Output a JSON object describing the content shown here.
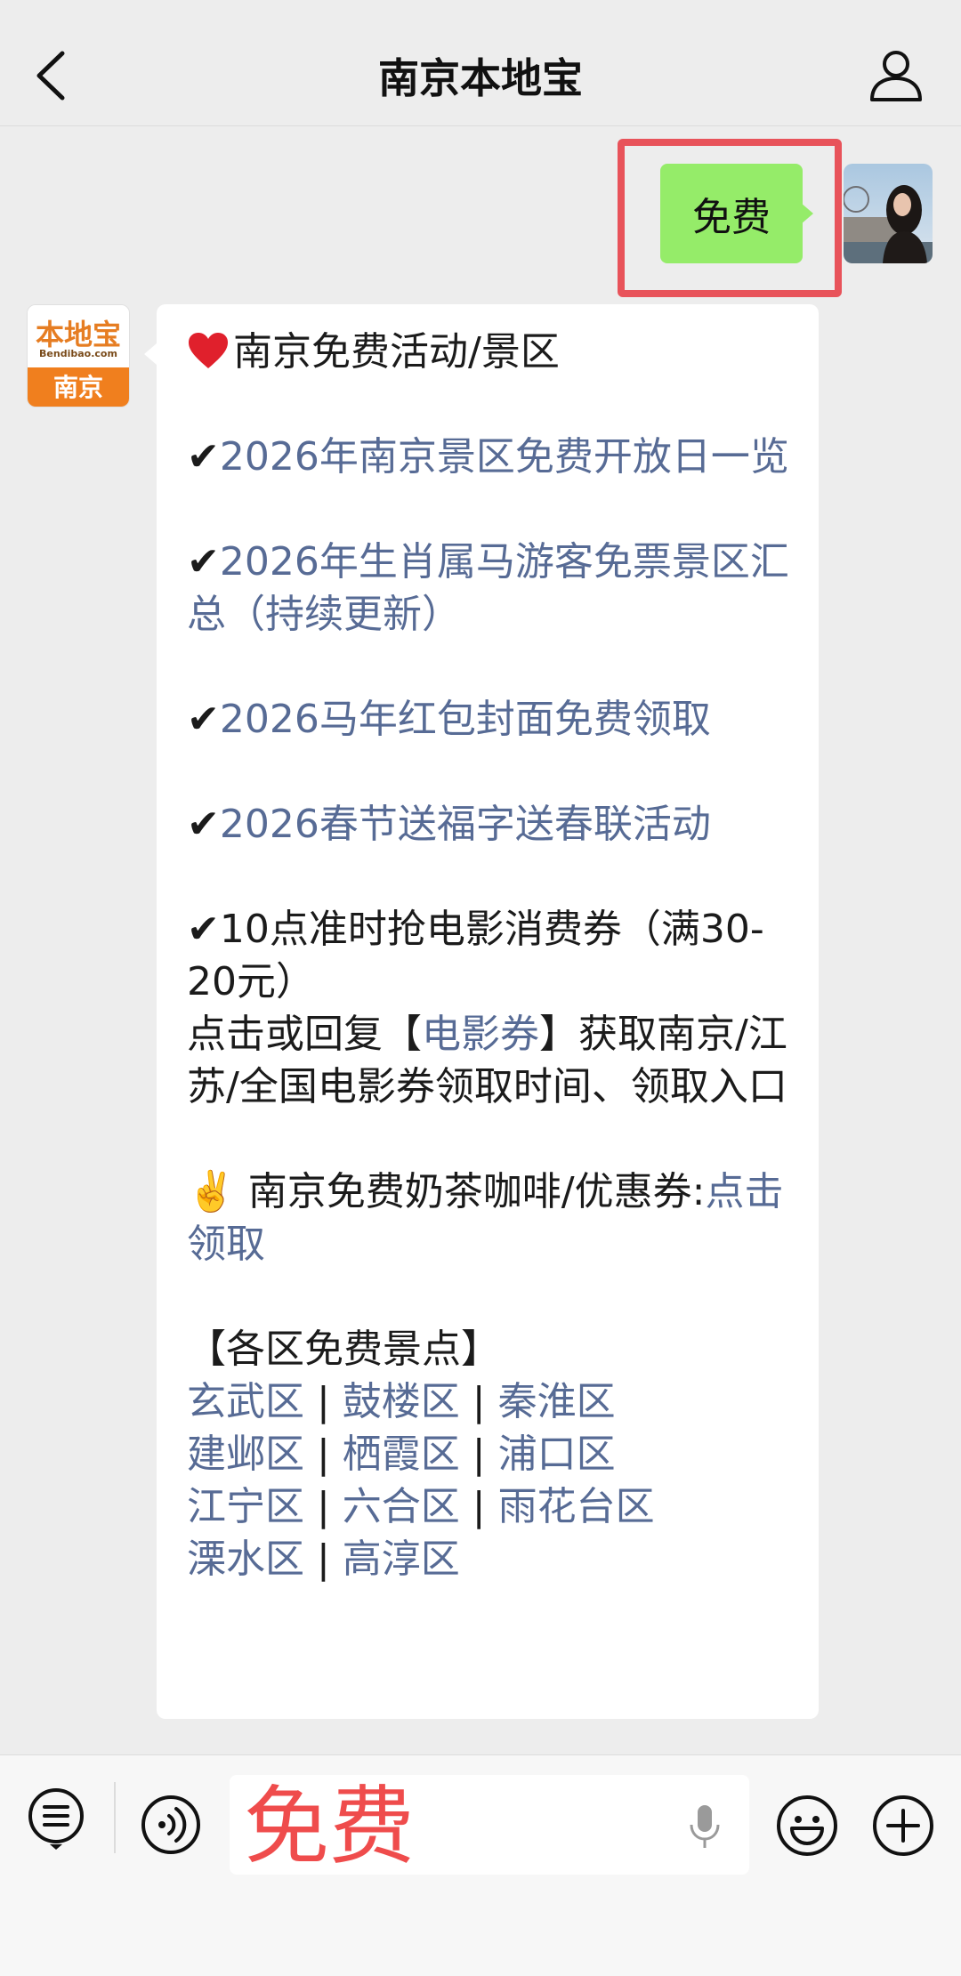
{
  "header": {
    "title": "南京本地宝"
  },
  "sent_message": {
    "text": "免费"
  },
  "bot": {
    "avatar_brand": "本地宝",
    "avatar_sub": "Bendibao.com",
    "avatar_city": "南京"
  },
  "reply": {
    "title": "南京免费活动/景区",
    "items": [
      {
        "check": "✔",
        "text": "2026年南京景区免费开放日一览"
      },
      {
        "check": "✔",
        "text": "2026年生肖属马游客免票景区汇总（持续更新）"
      },
      {
        "check": "✔",
        "text": "2026马年红包封面免费领取"
      },
      {
        "check": "✔",
        "text": "2026春节送福字送春联活动"
      }
    ],
    "movie": {
      "check": "✔",
      "line": "10点准时抢电影消费券（满30-20元）",
      "prefix": "点击或回复【",
      "link": "电影券",
      "suffix": "】获取南京/江苏/全国电影券领取时间、领取入口"
    },
    "tea": {
      "emoji": "✌️",
      "text": "南京免费奶茶咖啡/优惠券:",
      "link": "点击领取"
    },
    "districts_title": "【各区免费景点】",
    "districts": [
      [
        "玄武区",
        "鼓楼区",
        "秦淮区"
      ],
      [
        "建邺区",
        "栖霞区",
        "浦口区"
      ],
      [
        "江宁区",
        "六合区",
        "雨花台区"
      ],
      [
        "溧水区",
        "高淳区"
      ]
    ],
    "separator": " | "
  },
  "input": {
    "value": "免费"
  },
  "colors": {
    "link": "#576b95",
    "sent_bubble": "#95ec69",
    "highlight": "#e8535a",
    "input_text": "#ef4c4c"
  }
}
